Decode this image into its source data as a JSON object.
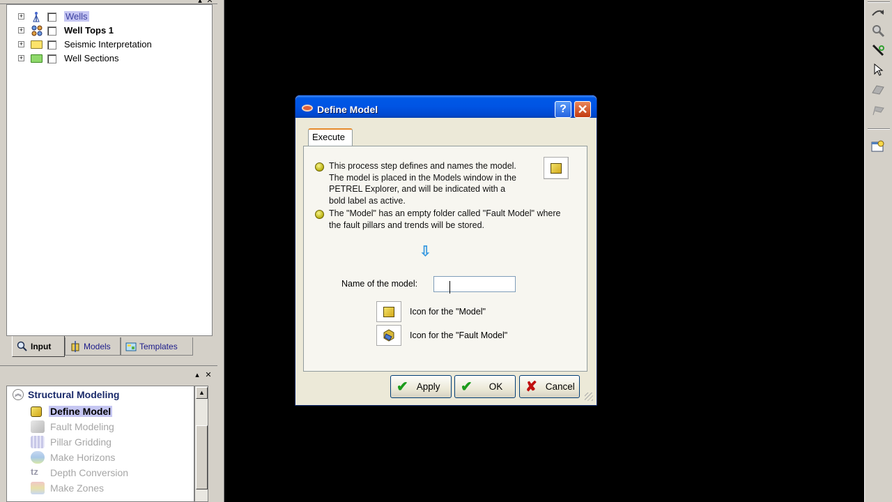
{
  "explorer": {
    "tree": [
      {
        "label": "Wells",
        "icon": "wells-icon",
        "selected": true
      },
      {
        "label": "Well Tops 1",
        "icon": "well-tops-icon",
        "bold": true
      },
      {
        "label": "Seismic Interpretation",
        "icon": "folder-icon"
      },
      {
        "label": "Well Sections",
        "icon": "green-folder-icon"
      }
    ],
    "tabs": [
      {
        "label": "Input",
        "active": true
      },
      {
        "label": "Models"
      },
      {
        "label": "Templates"
      }
    ]
  },
  "process": {
    "header": "Structural Modeling",
    "items": [
      {
        "label": "Define Model",
        "active": true
      },
      {
        "label": "Fault Modeling"
      },
      {
        "label": "Pillar Gridding"
      },
      {
        "label": "Make Horizons"
      },
      {
        "label": "Depth Conversion"
      },
      {
        "label": "Make Zones"
      }
    ]
  },
  "dialog": {
    "title": "Define Model",
    "help_glyph": "?",
    "close_glyph": "✕",
    "tab": "Execute",
    "para1": "This process step defines and names the model. The model is placed in the Models window in the PETREL Explorer, and will be indicated with a bold label as active.",
    "para2": "The \"Model\" has an empty folder called \"Fault Model\" where the fault pillars and trends will be stored.",
    "name_label": "Name of the model:",
    "name_value": "",
    "icon_model_label": "Icon for the \"Model\"",
    "icon_fault_label": "Icon for the \"Fault Model\"",
    "buttons": {
      "apply": "Apply",
      "ok": "OK",
      "cancel": "Cancel"
    }
  },
  "colors": {
    "titlebar": "#0054e3",
    "selection": "#c5c6f2",
    "ok_check": "#1b9b1b",
    "cancel_x": "#c01010"
  }
}
